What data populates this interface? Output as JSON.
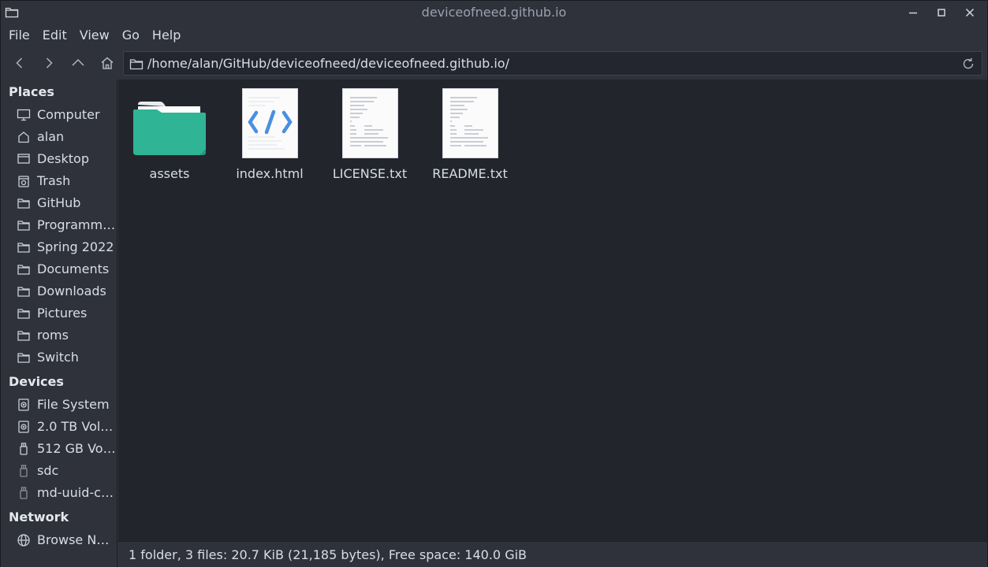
{
  "window": {
    "title": "deviceofneed.github.io"
  },
  "menu": [
    "File",
    "Edit",
    "View",
    "Go",
    "Help"
  ],
  "location": {
    "path": "/home/alan/GitHub/deviceofneed/deviceofneed.github.io/"
  },
  "sidebar": {
    "places_title": "Places",
    "places": [
      {
        "label": "Computer",
        "icon": "computer-icon"
      },
      {
        "label": "alan",
        "icon": "home-icon"
      },
      {
        "label": "Desktop",
        "icon": "desktop-icon"
      },
      {
        "label": "Trash",
        "icon": "trash-icon"
      },
      {
        "label": "GitHub",
        "icon": "folder-icon"
      },
      {
        "label": "Programm…",
        "icon": "folder-icon"
      },
      {
        "label": "Spring 2022",
        "icon": "folder-icon"
      },
      {
        "label": "Documents",
        "icon": "folder-icon"
      },
      {
        "label": "Downloads",
        "icon": "folder-icon"
      },
      {
        "label": "Pictures",
        "icon": "folder-icon"
      },
      {
        "label": "roms",
        "icon": "folder-icon"
      },
      {
        "label": "Switch",
        "icon": "folder-icon"
      }
    ],
    "devices_title": "Devices",
    "devices": [
      {
        "label": "File System",
        "icon": "drive-icon"
      },
      {
        "label": "2.0 TB Vol…",
        "icon": "drive-icon"
      },
      {
        "label": "512 GB Vo…",
        "icon": "usb-drive-icon"
      },
      {
        "label": "sdc",
        "icon": "usb-drive-icon"
      },
      {
        "label": "md-uuid-cf…",
        "icon": "usb-drive-icon"
      }
    ],
    "network_title": "Network",
    "network": [
      {
        "label": "Browse Ne…",
        "icon": "network-icon"
      }
    ]
  },
  "files": [
    {
      "name": "assets",
      "type": "folder"
    },
    {
      "name": "index.html",
      "type": "html"
    },
    {
      "name": "LICENSE.txt",
      "type": "text"
    },
    {
      "name": "README.txt",
      "type": "text"
    }
  ],
  "status": {
    "text": "1 folder, 3 files: 20.7 KiB (21,185 bytes), Free space: 140.0 GiB"
  },
  "colors": {
    "folder": "#2fb496",
    "background": "#22252c",
    "panel": "#2f323b",
    "html_code": "#4a8fe0"
  }
}
